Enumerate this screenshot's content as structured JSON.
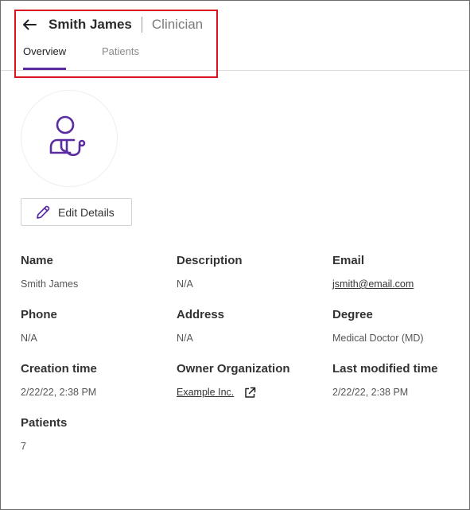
{
  "header": {
    "name": "Smith James",
    "role": "Clinician",
    "tabs": [
      {
        "label": "Overview",
        "active": true
      },
      {
        "label": "Patients",
        "active": false
      }
    ]
  },
  "edit_label": "Edit Details",
  "fields": {
    "name": {
      "label": "Name",
      "value": "Smith James"
    },
    "description": {
      "label": "Description",
      "value": "N/A"
    },
    "email": {
      "label": "Email",
      "value": "jsmith@email.com"
    },
    "phone": {
      "label": "Phone",
      "value": "N/A"
    },
    "address": {
      "label": "Address",
      "value": "N/A"
    },
    "degree": {
      "label": "Degree",
      "value": "Medical Doctor (MD)"
    },
    "creation_time": {
      "label": "Creation time",
      "value": "2/22/22, 2:38 PM"
    },
    "owner_org": {
      "label": "Owner Organization",
      "value": "Example Inc."
    },
    "last_modified": {
      "label": "Last modified time",
      "value": "2/22/22, 2:38 PM"
    },
    "patients": {
      "label": "Patients",
      "value": "7"
    }
  },
  "icons": {
    "back": "arrow-left-icon",
    "avatar": "clinician-stethoscope-icon",
    "edit": "pencil-icon",
    "external": "external-link-icon"
  },
  "colors": {
    "accent": "#5a2ca0",
    "highlight": "#d9141c"
  }
}
